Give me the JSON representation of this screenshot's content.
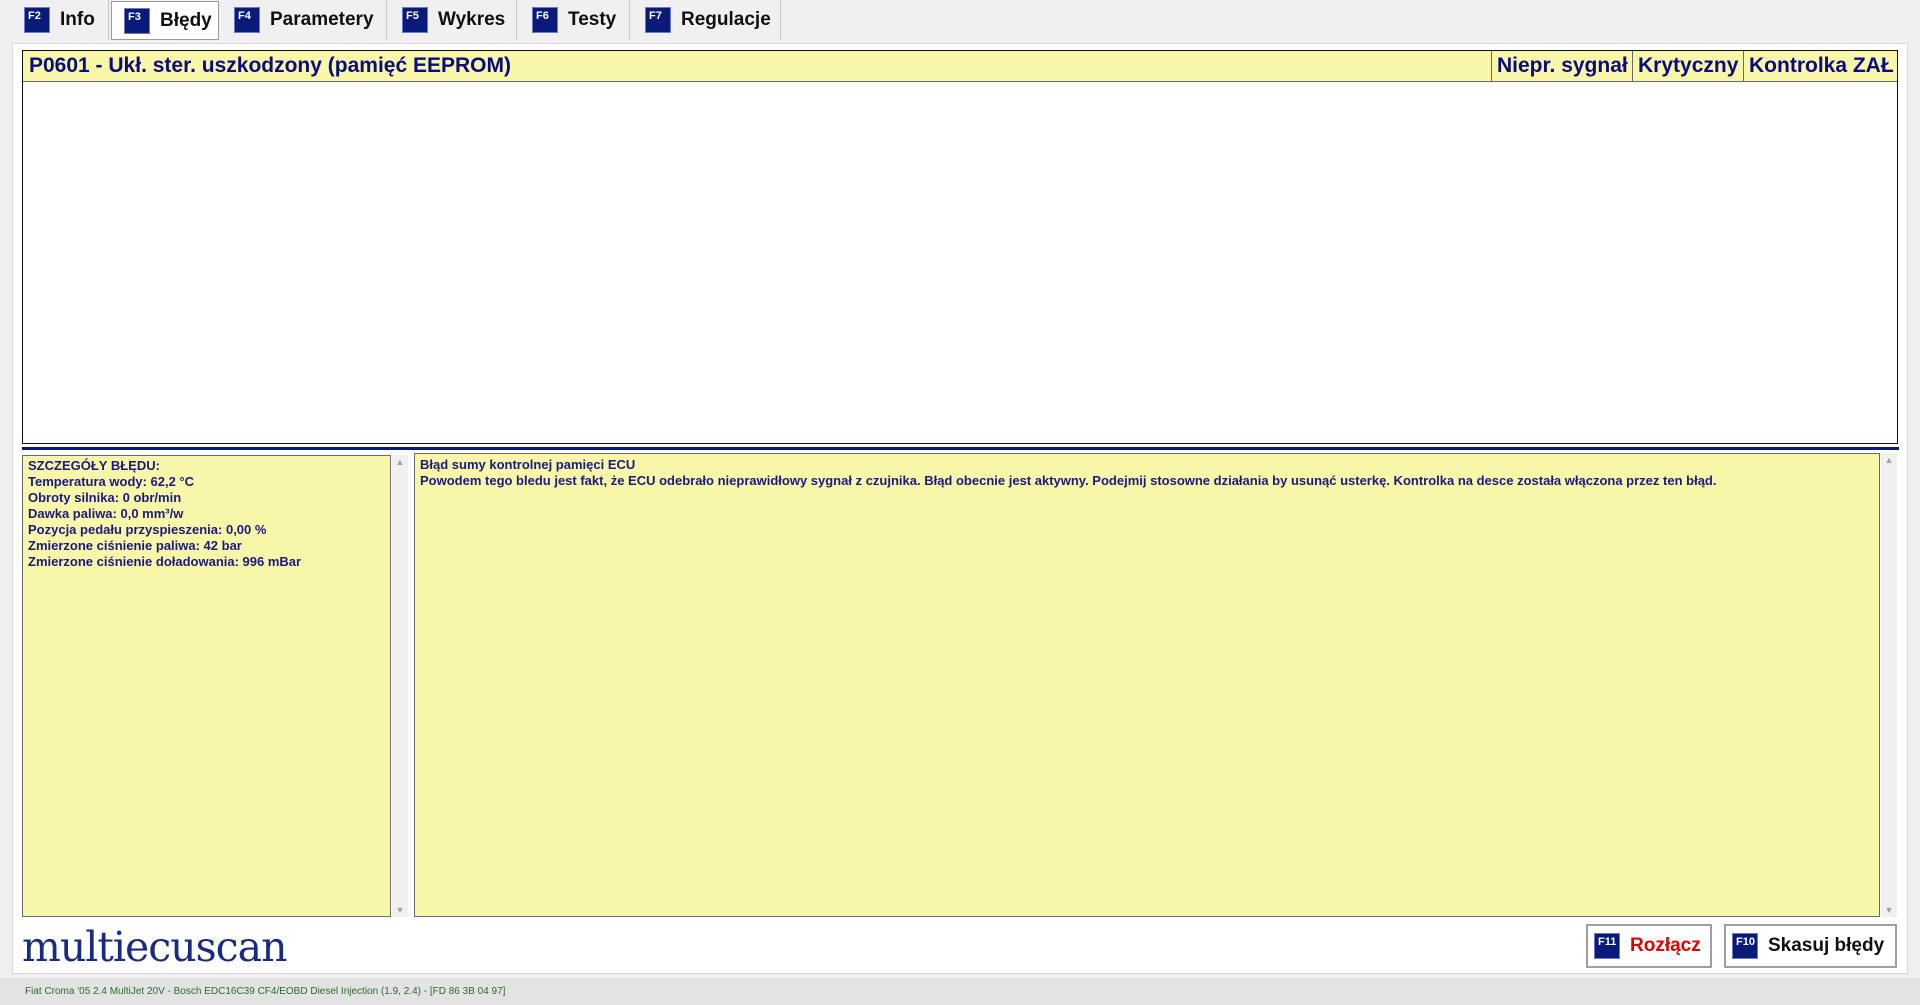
{
  "tabs": [
    {
      "key": "F2",
      "label": "Info"
    },
    {
      "key": "F3",
      "label": "Błędy"
    },
    {
      "key": "F4",
      "label": "Parametery"
    },
    {
      "key": "F5",
      "label": "Wykres"
    },
    {
      "key": "F6",
      "label": "Testy"
    },
    {
      "key": "F7",
      "label": "Regulacje"
    }
  ],
  "active_tab": "F3",
  "fault": {
    "code_text": "P0601 - Ukł. ster. uszkodzony (pamięć EEPROM)",
    "col_signal": "Niepr. sygnał",
    "col_critical": "Krytyczny",
    "col_lamp": "Kontrolka ZAŁ"
  },
  "details": {
    "heading": "SZCZEGÓŁY BŁĘDU:",
    "lines": [
      "Temperatura wody: 62,2 °C",
      "Obroty silnika: 0 obr/min",
      "Dawka paliwa: 0,0 mm³/w",
      "Pozycja pedału przyspieszenia: 0,00 %",
      "Zmierzone ciśnienie paliwa: 42 bar",
      "Zmierzone ciśnienie doładowania: 996 mBar"
    ]
  },
  "description": {
    "title": "Błąd sumy kontrolnej pamięci ECU",
    "body": "Powodem tego bledu jest fakt, że ECU odebrało nieprawidłowy sygnał z czujnika. Błąd obecnie jest aktywny. Podejmij stosowne działania by usunąć usterkę. Kontrolka na desce została włączona przez ten błąd."
  },
  "logo_text": "multiecuscan",
  "buttons": {
    "disconnect": {
      "key": "F11",
      "label": "Rozłącz",
      "color": "#e00000"
    },
    "clear": {
      "key": "F10",
      "label": "Skasuj błędy",
      "color": "#101010"
    }
  },
  "status_text": "Fiat Croma '05 2.4 MultiJet 20V - Bosch EDC16C39 CF4/EOBD Diesel Injection (1.9, 2.4) - [FD 86 3B 04 97]",
  "colors": {
    "accent": "#0a1a78",
    "panel_bg": "#f8f6a8",
    "text_blue": "#1a1a80"
  }
}
